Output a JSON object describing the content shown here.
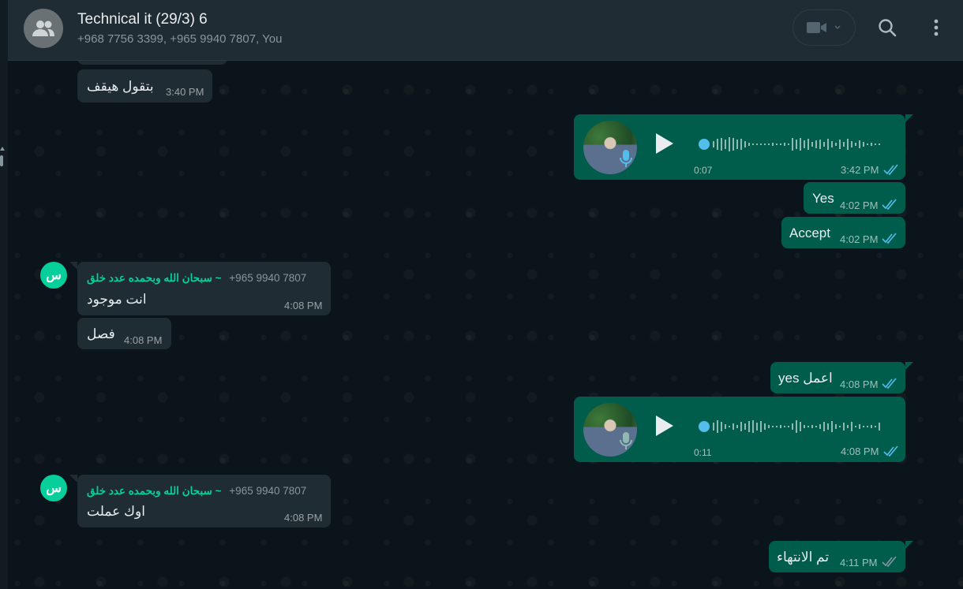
{
  "header": {
    "title": "Technical it (29/3) 6",
    "subtitle": "+968 7756 3399, +965 9940 7807, You"
  },
  "messages": {
    "m0": {
      "text": "بتقول هيقف",
      "time": "3:40 PM"
    },
    "m1": {
      "duration": "0:07",
      "time": "3:42 PM"
    },
    "m2": {
      "text": "Yes",
      "time": "4:02 PM"
    },
    "m3": {
      "text": "Accept",
      "time": "4:02 PM"
    },
    "m4": {
      "sender_number": "+965 9940 7807",
      "sender_name": "~ سبحان الله وبحمده عدد خلق",
      "avatar": "س",
      "text": "انت موجود",
      "time": "4:08 PM"
    },
    "m5": {
      "text": "فصل",
      "time": "4:08 PM"
    },
    "m6": {
      "text": "اعمل yes",
      "time": "4:08 PM"
    },
    "m7": {
      "duration": "0:11",
      "time": "4:08 PM"
    },
    "m8": {
      "sender_number": "+965 9940 7807",
      "sender_name": "~ سبحان الله وبحمده عدد خلق",
      "avatar": "س",
      "text": "اوك عملت",
      "time": "4:08 PM"
    },
    "m9": {
      "text": "تم الانتهاء",
      "time": "4:11 PM"
    }
  },
  "colors": {
    "background": "#0b141a",
    "header": "#202c33",
    "incoming_bubble": "#202c33",
    "outgoing_bubble": "#005c4b",
    "accent_green": "#06cf9c",
    "read_ticks": "#53bdeb"
  },
  "icons": [
    "group-avatar-icon",
    "video-call-icon",
    "chevron-down-icon",
    "search-icon",
    "menu-dots-icon",
    "play-icon",
    "mic-icon",
    "double-check-icon"
  ]
}
